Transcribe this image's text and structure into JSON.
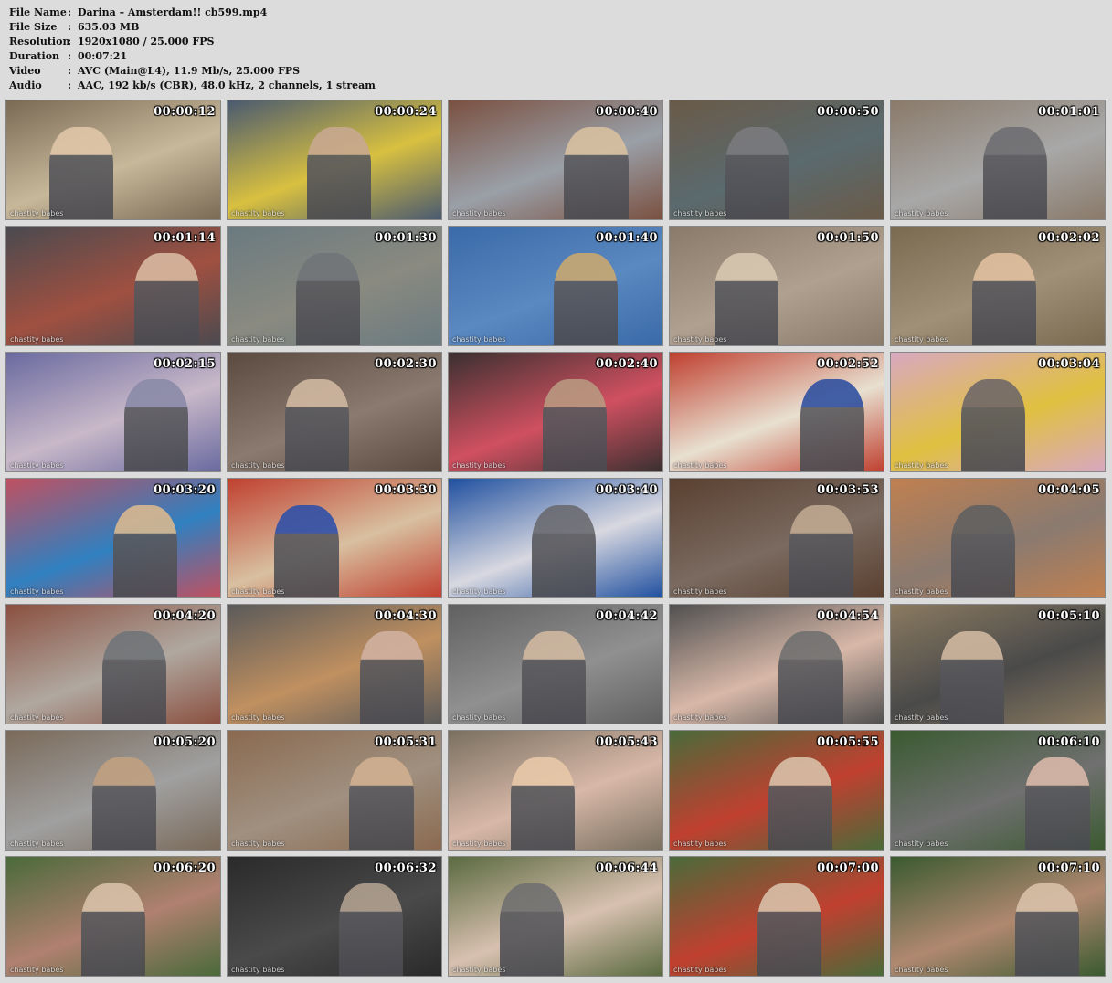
{
  "info": [
    {
      "label": "File Name",
      "value": "Darina – Amsterdam!! cb599.mp4"
    },
    {
      "label": "File Size",
      "value": "635.03 MB"
    },
    {
      "label": "Resolution",
      "value": "1920x1080 / 25.000 FPS"
    },
    {
      "label": "Duration",
      "value": "00:07:21"
    },
    {
      "label": "Video",
      "value": "AVC (Main@L4), 11.9 Mb/s, 25.000 FPS"
    },
    {
      "label": "Audio",
      "value": "AAC, 192 kb/s (CBR), 48.0 kHz, 2 channels, 1 stream"
    }
  ],
  "separator": ":",
  "watermark_text": "chastity babes",
  "thumbnails": [
    {
      "time": "00:00:12",
      "palette": [
        "#7a6a55",
        "#c8b89a",
        "#e0c6a8"
      ]
    },
    {
      "time": "00:00:24",
      "palette": [
        "#4a5a70",
        "#d8c040",
        "#c8a890"
      ]
    },
    {
      "time": "00:00:40",
      "palette": [
        "#7a5040",
        "#9aa0a8",
        "#d8c0a0"
      ]
    },
    {
      "time": "00:00:50",
      "palette": [
        "#6a5a48",
        "#5a6a6e",
        "#7a7a7e"
      ]
    },
    {
      "time": "00:01:01",
      "palette": [
        "#8a7a6a",
        "#a8a8a8",
        "#6e6e72"
      ]
    },
    {
      "time": "00:01:14",
      "palette": [
        "#4a4a50",
        "#a05040",
        "#d8b8a0"
      ]
    },
    {
      "time": "00:01:30",
      "palette": [
        "#6a7a80",
        "#8a8a80",
        "#707478"
      ]
    },
    {
      "time": "00:01:40",
      "palette": [
        "#3a6aa8",
        "#5a88c0",
        "#c8a870"
      ]
    },
    {
      "time": "00:01:50",
      "palette": [
        "#8a7a6a",
        "#b0a090",
        "#d8c8b0"
      ]
    },
    {
      "time": "00:02:02",
      "palette": [
        "#7a6a50",
        "#a09078",
        "#e0c0a0"
      ]
    },
    {
      "time": "00:02:15",
      "palette": [
        "#6a6aa0",
        "#c8b8c8",
        "#8a8aa8"
      ]
    },
    {
      "time": "00:02:30",
      "palette": [
        "#5a4a40",
        "#8a7a70",
        "#d0b8a0"
      ]
    },
    {
      "time": "00:02:40",
      "palette": [
        "#3a3030",
        "#d05060",
        "#b89880"
      ]
    },
    {
      "time": "00:02:52",
      "palette": [
        "#c04030",
        "#e8e0d0",
        "#3050a0"
      ]
    },
    {
      "time": "00:03:04",
      "palette": [
        "#d8a8c0",
        "#e0c040",
        "#706868"
      ]
    },
    {
      "time": "00:03:20",
      "palette": [
        "#c05060",
        "#3080c0",
        "#d8b890"
      ]
    },
    {
      "time": "00:03:30",
      "palette": [
        "#c04030",
        "#d8c0a0",
        "#3050a8"
      ]
    },
    {
      "time": "00:03:40",
      "palette": [
        "#2050a0",
        "#d8d8e0",
        "#6a6a70"
      ]
    },
    {
      "time": "00:03:53",
      "palette": [
        "#5a4030",
        "#7a6a60",
        "#c0a890"
      ]
    },
    {
      "time": "00:04:05",
      "palette": [
        "#c08050",
        "#8a7a70",
        "#606060"
      ]
    },
    {
      "time": "00:04:20",
      "palette": [
        "#8a5040",
        "#b0a8a0",
        "#707478"
      ]
    },
    {
      "time": "00:04:30",
      "palette": [
        "#5a5a5a",
        "#c09060",
        "#d0b0a0"
      ]
    },
    {
      "time": "00:04:42",
      "palette": [
        "#606060",
        "#909090",
        "#d0b8a0"
      ]
    },
    {
      "time": "00:04:54",
      "palette": [
        "#505050",
        "#d8b8a8",
        "#707070"
      ]
    },
    {
      "time": "00:05:10",
      "palette": [
        "#8a7a60",
        "#4a4a4a",
        "#d0b8a0"
      ]
    },
    {
      "time": "00:05:20",
      "palette": [
        "#7a6a5a",
        "#a0a0a0",
        "#c0a080"
      ]
    },
    {
      "time": "00:05:31",
      "palette": [
        "#8a6a50",
        "#a09080",
        "#d0b090"
      ]
    },
    {
      "time": "00:05:43",
      "palette": [
        "#7a7060",
        "#d8b8a8",
        "#e8c8a8"
      ]
    },
    {
      "time": "00:05:55",
      "palette": [
        "#4a6a3a",
        "#c04030",
        "#d8c0a8"
      ]
    },
    {
      "time": "00:06:10",
      "palette": [
        "#3a5a30",
        "#707070",
        "#d8b8a8"
      ]
    },
    {
      "time": "00:06:20",
      "palette": [
        "#4a6a3a",
        "#b08070",
        "#d8c0a8"
      ]
    },
    {
      "time": "00:06:32",
      "palette": [
        "#2a2a2a",
        "#4a4a4a",
        "#b0a090"
      ]
    },
    {
      "time": "00:06:44",
      "palette": [
        "#5a6a40",
        "#d8c0b0",
        "#707070"
      ]
    },
    {
      "time": "00:07:00",
      "palette": [
        "#4a6a3a",
        "#c04030",
        "#d8c0a8"
      ]
    },
    {
      "time": "00:07:10",
      "palette": [
        "#3a5a30",
        "#b08870",
        "#d8c0a8"
      ]
    }
  ]
}
